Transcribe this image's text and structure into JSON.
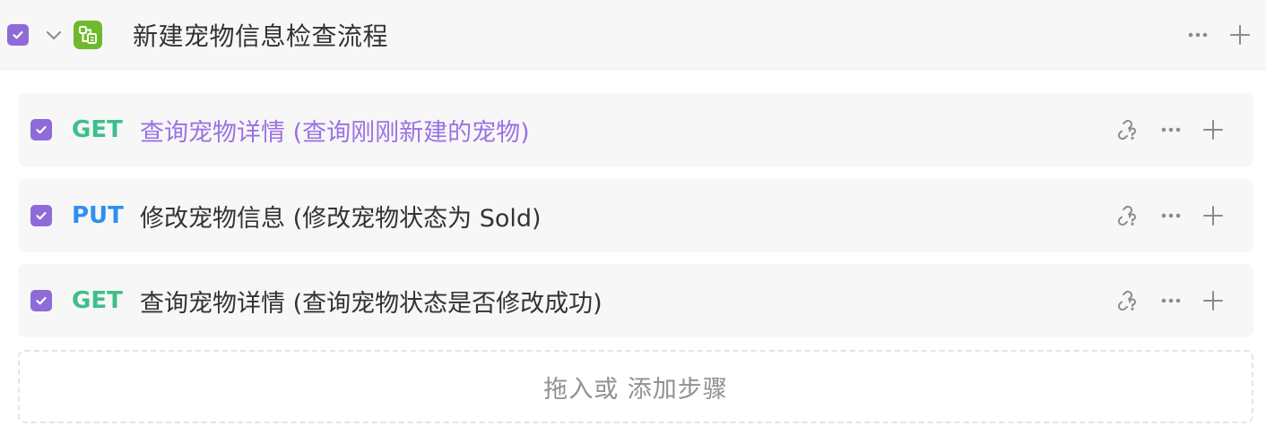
{
  "group": {
    "checked": true,
    "title": "新建宠物信息检查流程",
    "icon": "flow-group-icon",
    "icon_color": "#6fba2c"
  },
  "steps": [
    {
      "checked": true,
      "method": "GET",
      "method_color": "#3dbf8a",
      "title": "查询宠物详情 (查询刚刚新建的宠物)",
      "title_color": "#9b72e3"
    },
    {
      "checked": true,
      "method": "PUT",
      "method_color": "#2f8ff0",
      "title": "修改宠物信息 (修改宠物状态为 Sold)",
      "title_color": "#333333"
    },
    {
      "checked": true,
      "method": "GET",
      "method_color": "#3dbf8a",
      "title": "查询宠物详情 (查询宠物状态是否修改成功)",
      "title_color": "#333333"
    }
  ],
  "add_step": {
    "label": "拖入或 添加步骤"
  },
  "colors": {
    "checkbox": "#8e6bd8",
    "row_background": "#f7f7f8",
    "icon_gray": "#8a8a90"
  }
}
